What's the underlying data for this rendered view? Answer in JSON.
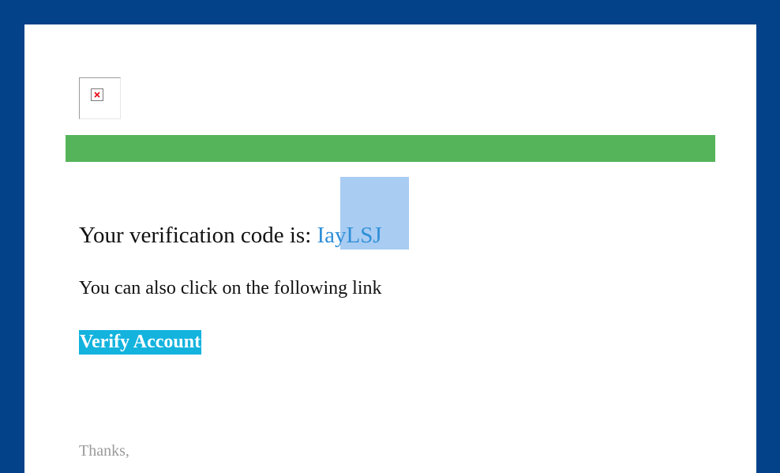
{
  "colors": {
    "background": "#034189",
    "card": "#ffffff",
    "accent_bar": "#55b45a",
    "code_text": "#2f8fd8",
    "code_selection": "#a9ccf2",
    "button_bg": "#13b3de",
    "button_text": "#ffffff",
    "muted_text": "#9a9a9a"
  },
  "header": {
    "logo_icon": "broken-image-icon"
  },
  "body": {
    "code_label": "Your verification code is: ",
    "code_value": "IayLSJ",
    "link_intro": "You can also click on the following link",
    "verify_button_label": "Verify Account"
  },
  "footer": {
    "thanks": "Thanks,"
  }
}
